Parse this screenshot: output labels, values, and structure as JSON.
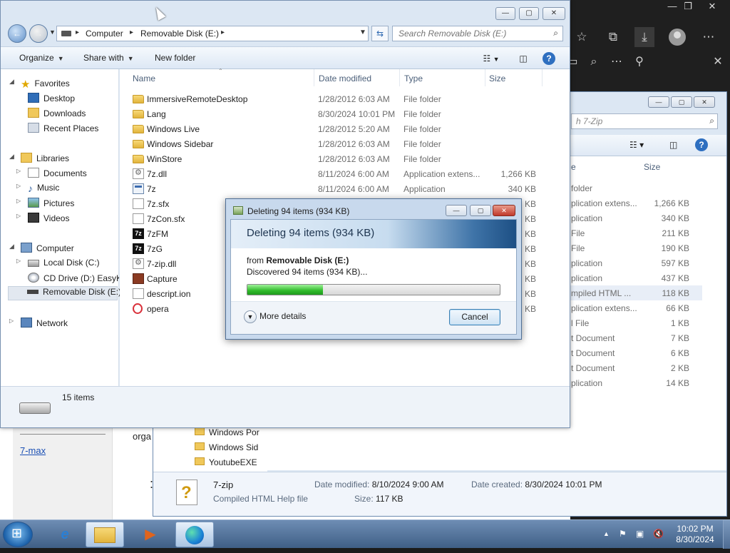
{
  "explorer": {
    "address": {
      "crumbs": [
        "Computer",
        "Removable Disk (E:)"
      ]
    },
    "search_placeholder": "Search Removable Disk (E:)",
    "commands": {
      "organize": "Organize",
      "share_with": "Share with",
      "new_folder": "New folder"
    },
    "nav": {
      "favorites": "Favorites",
      "desktop": "Desktop",
      "downloads": "Downloads",
      "recent_places": "Recent Places",
      "libraries": "Libraries",
      "documents": "Documents",
      "music": "Music",
      "pictures": "Pictures",
      "videos": "Videos",
      "computer": "Computer",
      "local_disk": "Local Disk (C:)",
      "cd_drive": "CD Drive (D:) EasyKMS",
      "removable_disk": "Removable Disk (E:)",
      "network": "Network"
    },
    "columns": {
      "name": "Name",
      "date": "Date modified",
      "type": "Type",
      "size": "Size"
    },
    "files": [
      {
        "name": "ImmersiveRemoteDesktop",
        "date": "1/28/2012 6:03 AM",
        "type": "File folder",
        "size": "",
        "icon": "folder"
      },
      {
        "name": "Lang",
        "date": "8/30/2024 10:01 PM",
        "type": "File folder",
        "size": "",
        "icon": "folder"
      },
      {
        "name": "Windows Live",
        "date": "1/28/2012 5:20 AM",
        "type": "File folder",
        "size": "",
        "icon": "folder"
      },
      {
        "name": "Windows Sidebar",
        "date": "1/28/2012 6:03 AM",
        "type": "File folder",
        "size": "",
        "icon": "folder"
      },
      {
        "name": "WinStore",
        "date": "1/28/2012 6:03 AM",
        "type": "File folder",
        "size": "",
        "icon": "folder"
      },
      {
        "name": "7z.dll",
        "date": "8/11/2024 6:00 AM",
        "type": "Application extens...",
        "size": "1,266 KB",
        "icon": "dll"
      },
      {
        "name": "7z",
        "date": "8/11/2024 6:00 AM",
        "type": "Application",
        "size": "340 KB",
        "icon": "app"
      },
      {
        "name": "7z.sfx",
        "date": "",
        "type": "",
        "size": "KB",
        "icon": "file"
      },
      {
        "name": "7zCon.sfx",
        "date": "",
        "type": "",
        "size": "KB",
        "icon": "file"
      },
      {
        "name": "7zFM",
        "date": "",
        "type": "",
        "size": "KB",
        "icon": "7z"
      },
      {
        "name": "7zG",
        "date": "",
        "type": "",
        "size": "KB",
        "icon": "7z"
      },
      {
        "name": "7-zip.dll",
        "date": "",
        "type": "",
        "size": "KB",
        "icon": "dll"
      },
      {
        "name": "Capture",
        "date": "",
        "type": "",
        "size": "KB",
        "icon": "capture"
      },
      {
        "name": "descript.ion",
        "date": "",
        "type": "",
        "size": "KB",
        "icon": "file"
      },
      {
        "name": "opera",
        "date": "",
        "type": "",
        "size": "KB",
        "icon": "opera"
      }
    ],
    "status_count": "15 items"
  },
  "dialog": {
    "title": "Deleting 94 items (934 KB)",
    "header": "Deleting 94 items (934 KB)",
    "from_label": "from",
    "from_value": "Removable Disk (E:)",
    "discovered": "Discovered 94 items (934 KB)...",
    "progress_fraction": 0.3,
    "more_details": "More details",
    "cancel": "Cancel"
  },
  "win2": {
    "search_placeholder": "h 7-Zip",
    "size_header": "Size",
    "type_header_fragment": "e",
    "rows": [
      {
        "type": "folder",
        "size": ""
      },
      {
        "type": "plication extens...",
        "size": "1,266 KB"
      },
      {
        "type": "plication",
        "size": "340 KB"
      },
      {
        "type": "File",
        "size": "211 KB"
      },
      {
        "type": "File",
        "size": "190 KB"
      },
      {
        "type": "plication",
        "size": "597 KB"
      },
      {
        "type": "plication",
        "size": "437 KB"
      },
      {
        "type": "mpiled HTML ...",
        "size": "118 KB"
      },
      {
        "type": "plication extens...",
        "size": "66 KB"
      },
      {
        "type": "l File",
        "size": "1 KB"
      },
      {
        "type": "t Document",
        "size": "7 KB"
      },
      {
        "type": "t Document",
        "size": "6 KB"
      },
      {
        "type": "t Document",
        "size": "2 KB"
      },
      {
        "type": "plication",
        "size": "14 KB"
      }
    ],
    "tree": [
      "Windows Por",
      "Windows Sid",
      "YoutubeEXE"
    ],
    "details": {
      "name": "7-zip",
      "kind": "Compiled HTML Help file",
      "modified_label": "Date modified:",
      "modified_value": "8/10/2024 9:00 AM",
      "created_label": "Date created:",
      "created_value": "8/30/2024 10:01 PM",
      "size_label": "Size:",
      "size_value": "117 KB"
    }
  },
  "webpage": {
    "link": "7-max",
    "text": "orga",
    "bullet": ":"
  },
  "taskbar": {
    "time": "10:02 PM",
    "date": "8/30/2024"
  },
  "colors": {
    "progress": "#2fba2a",
    "selection": "#e2e8f0",
    "accent": "#3c7fb1"
  }
}
